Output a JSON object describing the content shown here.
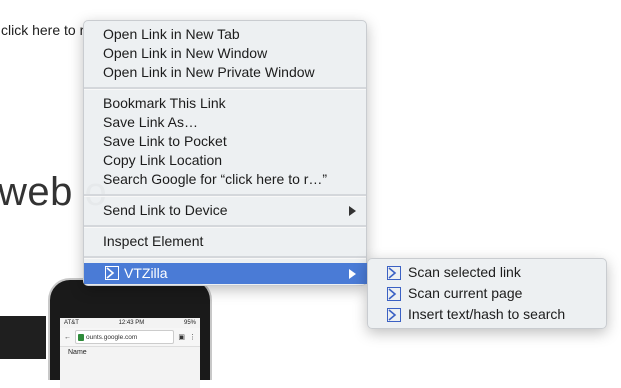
{
  "page": {
    "link_text": "click here to r",
    "heading_fragment": "web o"
  },
  "phone": {
    "carrier": "AT&T",
    "time": "12:43 PM",
    "battery": "95%",
    "url": "ounts.google.com",
    "column": "Name"
  },
  "menu": {
    "open_new_tab": "Open Link in New Tab",
    "open_new_window": "Open Link in New Window",
    "open_private_window": "Open Link in New Private Window",
    "bookmark": "Bookmark This Link",
    "save_as": "Save Link As…",
    "save_pocket": "Save Link to Pocket",
    "copy_location": "Copy Link Location",
    "search_google": "Search Google for “click here to r…”",
    "send_to_device": "Send Link to Device",
    "inspect": "Inspect Element",
    "vtzilla": "VTZilla"
  },
  "submenu": {
    "scan_link": "Scan selected link",
    "scan_page": "Scan current page",
    "insert_hash": "Insert text/hash to search"
  },
  "colors": {
    "highlight": "#4a7bd6",
    "menu_bg": "#eceff2",
    "vt_icon": "#3b61c4"
  }
}
